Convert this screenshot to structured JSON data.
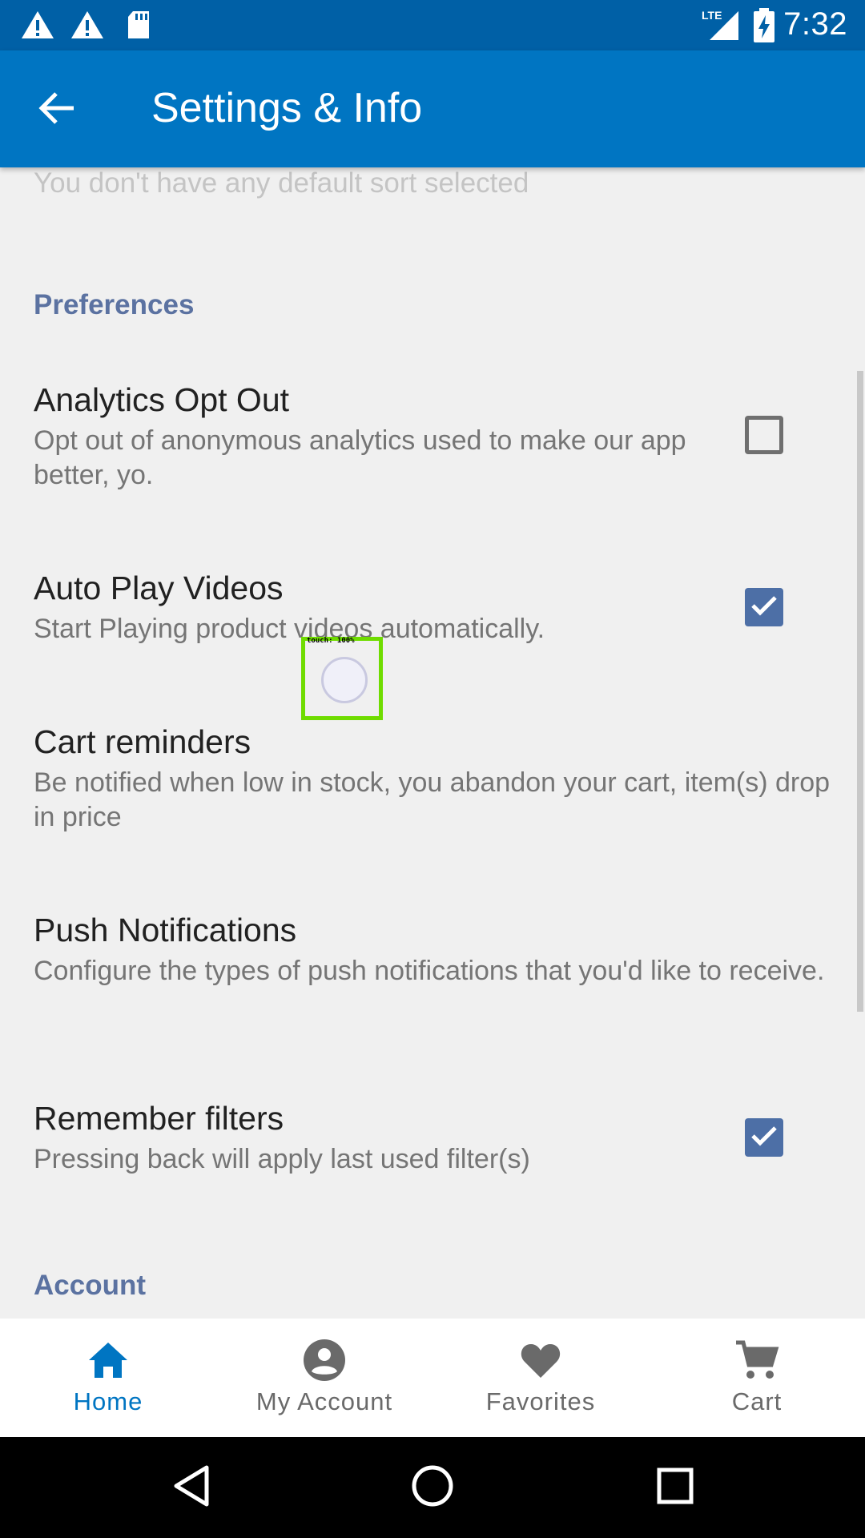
{
  "status_bar": {
    "time": "7:32",
    "icons": [
      "warning-icon",
      "warning-icon",
      "sd-card-icon",
      "lte-signal-icon",
      "battery-charging-icon"
    ],
    "network_label": "LTE"
  },
  "app_bar": {
    "back_icon": "arrow-back-icon",
    "title": "Settings & Info"
  },
  "content": {
    "faded_text": "You don't have any default sort selected",
    "preferences_header": "Preferences",
    "items": [
      {
        "title": "Analytics Opt Out",
        "summary": "Opt out of anonymous analytics used to make our app better, yo.",
        "checked": false
      },
      {
        "title": "Auto Play Videos",
        "summary": "Start Playing product videos automatically.",
        "checked": true
      },
      {
        "title": "Cart reminders",
        "summary": "Be notified when low in stock, you abandon your cart, item(s) drop in price"
      },
      {
        "title": "Push Notifications",
        "summary": "Configure the types of push notifications that you'd like to receive."
      },
      {
        "title": "Remember filters",
        "summary": "Pressing back will apply last used filter(s)",
        "checked": true
      }
    ],
    "account_header": "Account"
  },
  "touch_indicator": {
    "label": "touch: 100%"
  },
  "bottom_nav": {
    "items": [
      {
        "label": "Home",
        "icon": "home-icon",
        "active": true
      },
      {
        "label": "My Account",
        "icon": "account-circle-icon",
        "active": false
      },
      {
        "label": "Favorites",
        "icon": "heart-icon",
        "active": false
      },
      {
        "label": "Cart",
        "icon": "cart-icon",
        "active": false
      }
    ]
  },
  "system_nav": {
    "buttons": [
      "back-triangle-icon",
      "home-circle-icon",
      "recents-square-icon"
    ]
  },
  "colors": {
    "status_bar": "#0060a6",
    "app_bar": "#0075c2",
    "section_header": "#5b72a1",
    "checkbox_checked": "#4d6fa6",
    "nav_active": "#0075c2"
  }
}
